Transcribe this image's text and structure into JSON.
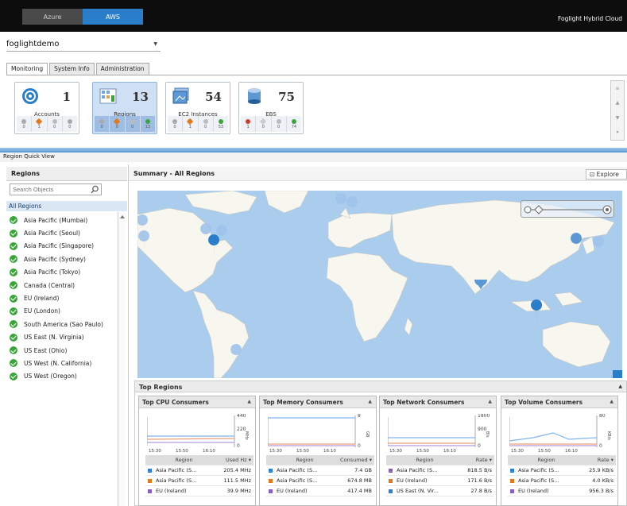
{
  "topbar": {
    "tabs": [
      {
        "label": "Azure"
      },
      {
        "label": "AWS"
      }
    ],
    "brand": "Foglight Hybrid Cloud"
  },
  "account_select": {
    "value": "foglightdemo"
  },
  "main_tabs": [
    {
      "label": "Monitoring"
    },
    {
      "label": "System Info"
    },
    {
      "label": "Administration"
    }
  ],
  "tiles": [
    {
      "label": "Accounts",
      "count": "1",
      "stats": [
        "0",
        "1",
        "0",
        "0"
      ]
    },
    {
      "label": "Regions",
      "count": "13",
      "stats": [
        "0",
        "0",
        "0",
        "13"
      ]
    },
    {
      "label": "EC2 Instances",
      "count": "54",
      "stats": [
        "0",
        "1",
        "0",
        "53"
      ]
    },
    {
      "label": "EBS",
      "count": "75",
      "stats": [
        "1",
        "0",
        "0",
        "74"
      ]
    }
  ],
  "quick_view_label": "Region Quick View",
  "sidebar": {
    "title": "Regions",
    "search_placeholder": "Search Objects",
    "all_label": "All Regions",
    "regions": [
      "Asia Pacific (Mumbai)",
      "Asia Pacific (Seoul)",
      "Asia Pacific (Singapore)",
      "Asia Pacific (Sydney)",
      "Asia Pacific (Tokyo)",
      "Canada (Central)",
      "EU (Ireland)",
      "EU (London)",
      "South America (Sao Paulo)",
      "US East (N. Virginia)",
      "US East (Ohio)",
      "US West (N. California)",
      "US West (Oregon)"
    ]
  },
  "summary": {
    "title": "Summary - All Regions",
    "explore_label": "Explore"
  },
  "top_regions": {
    "title": "Top Regions",
    "cards": [
      {
        "title": "Top CPU Consumers",
        "unit": "MHz",
        "axis": [
          "440",
          "220",
          "0"
        ],
        "times": [
          "15:30",
          "15:50",
          "16:10"
        ],
        "col_region": "Region",
        "col_value": "Used Hz",
        "rows": [
          {
            "name": "Asia Pacific (S...",
            "value": "205.4 MHz",
            "color": "#2e7fd6"
          },
          {
            "name": "Asia Pacific (S...",
            "value": "111.5 MHz",
            "color": "#e07a1c"
          },
          {
            "name": "EU (Ireland)",
            "value": "39.9 MHz",
            "color": "#8a5cc4"
          }
        ]
      },
      {
        "title": "Top Memory Consumers",
        "unit": "GB",
        "axis": [
          "8",
          "0"
        ],
        "times": [
          "15:30",
          "15:50",
          "16:10"
        ],
        "col_region": "Region",
        "col_value": "Consumed",
        "rows": [
          {
            "name": "Asia Pacific (S...",
            "value": "7.4 GB",
            "color": "#2e7fd6"
          },
          {
            "name": "Asia Pacific (S...",
            "value": "674.8 MB",
            "color": "#e07a1c"
          },
          {
            "name": "EU (Ireland)",
            "value": "417.4 MB",
            "color": "#8a5cc4"
          }
        ]
      },
      {
        "title": "Top Network Consumers",
        "unit": "B/s",
        "axis": [
          "1800",
          "900",
          "0"
        ],
        "times": [
          "15:30",
          "15:50",
          "16:10"
        ],
        "col_region": "Region",
        "col_value": "Rate",
        "rows": [
          {
            "name": "Asia Pacific (S...",
            "value": "818.5 B/s",
            "color": "#8a5cc4"
          },
          {
            "name": "EU (Ireland)",
            "value": "171.6 B/s",
            "color": "#e07a1c"
          },
          {
            "name": "US East (N. Vir...",
            "value": "27.8 B/s",
            "color": "#2e7fd6"
          }
        ]
      },
      {
        "title": "Top Volume Consumers",
        "unit": "KB/s",
        "axis": [
          "80",
          "0"
        ],
        "times": [
          "15:30",
          "15:50",
          "16:10"
        ],
        "col_region": "Region",
        "col_value": "Rate",
        "rows": [
          {
            "name": "Asia Pacific (S...",
            "value": "25.9 KB/s",
            "color": "#2e7fd6"
          },
          {
            "name": "Asia Pacific (S...",
            "value": "4.0 KB/s",
            "color": "#e07a1c"
          },
          {
            "name": "EU (Ireland)",
            "value": "956.3 B/s",
            "color": "#8a5cc4"
          }
        ]
      }
    ]
  }
}
